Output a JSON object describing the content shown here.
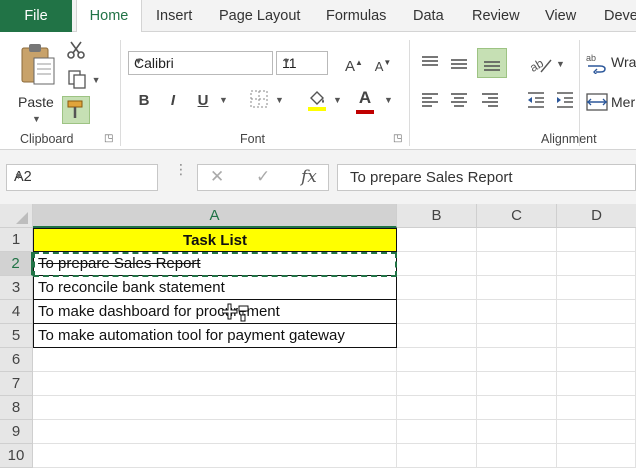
{
  "ribbon": {
    "tabs": [
      "File",
      "Home",
      "Insert",
      "Page Layout",
      "Formulas",
      "Data",
      "Review",
      "View",
      "Deve"
    ],
    "clipboard": {
      "paste_label": "Paste",
      "group_label": "Clipboard"
    },
    "font": {
      "font_name": "Calibri",
      "font_size": "11",
      "group_label": "Font",
      "bold": "B",
      "italic": "I",
      "underline": "U",
      "grow": "A",
      "shrink": "A"
    },
    "alignment": {
      "wrap_label": "Wra",
      "merge_label": "Mer",
      "group_label": "Alignment"
    }
  },
  "formula_bar": {
    "name_box": "A2",
    "fx_label": "fx",
    "value": "To prepare Sales Report"
  },
  "sheet": {
    "columns": [
      "A",
      "B",
      "C",
      "D"
    ],
    "rows": [
      "1",
      "2",
      "3",
      "4",
      "5",
      "6",
      "7",
      "8",
      "9",
      "10"
    ],
    "header": "Task List",
    "tasks": [
      "To prepare Sales Report",
      "To reconcile bank statement",
      "To make dashboard for procurement",
      "To make automation tool for payment gateway"
    ],
    "selected_cell": "A2",
    "struck_rows": [
      "2"
    ]
  },
  "colors": {
    "accent": "#217346",
    "header_fill": "#ffff00"
  }
}
